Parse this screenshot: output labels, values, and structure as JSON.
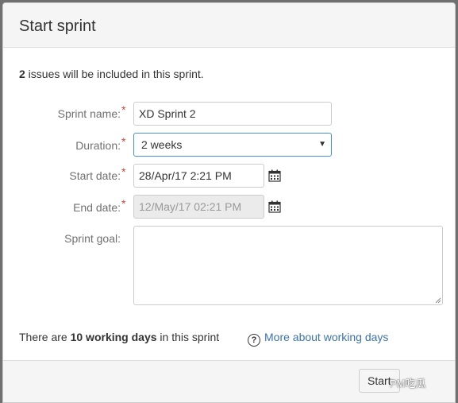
{
  "dialog": {
    "title": "Start sprint"
  },
  "issues": {
    "count": "2",
    "text": " issues will be included in this sprint."
  },
  "form": {
    "sprint_name": {
      "label": "Sprint name:",
      "value": "XD Sprint 2"
    },
    "duration": {
      "label": "Duration:",
      "value": "2 weeks"
    },
    "start_date": {
      "label": "Start date:",
      "value": "28/Apr/17 2:21 PM"
    },
    "end_date": {
      "label": "End date:",
      "value": "12/May/17 02:21 PM"
    },
    "sprint_goal": {
      "label": "Sprint goal:",
      "value": ""
    },
    "required_marker": "*"
  },
  "working_days": {
    "prefix": "There are ",
    "count_text": "10 working days",
    "suffix": " in this sprint",
    "help_icon": "question-circle-icon",
    "help_glyph": "?",
    "help_link": "More about working days"
  },
  "footer": {
    "start_label": "Start",
    "watermark": "PM吃瓜"
  },
  "colors": {
    "required": "#d04437",
    "link": "#3b73af",
    "focus_border": "#4a90d9",
    "header_bg": "#f5f5f5"
  }
}
